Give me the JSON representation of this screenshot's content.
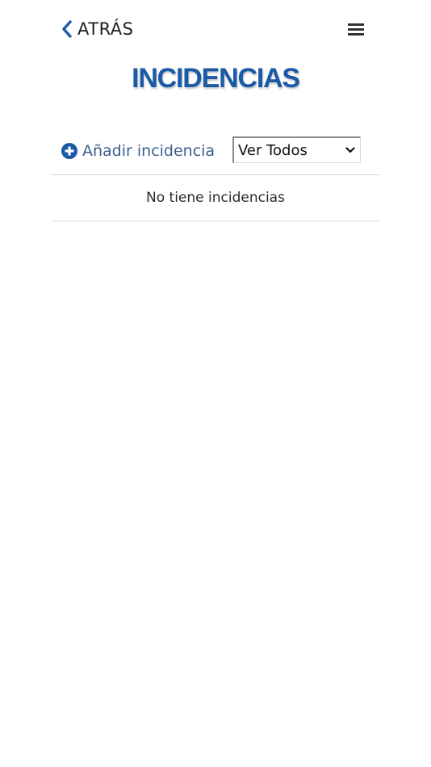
{
  "header": {
    "back_label": "ATRÁS",
    "back_icon": "chevron-left-icon",
    "menu_icon": "hamburger-menu-icon"
  },
  "page": {
    "title": "INCIDENCIAS"
  },
  "toolbar": {
    "add_label": "Añadir incidencia",
    "add_icon": "plus-circle-icon",
    "filter": {
      "selected": "Ver Todos"
    }
  },
  "list": {
    "empty_message": "No tiene incidencias"
  },
  "colors": {
    "brand_blue": "#1b5aa6",
    "link_blue": "#3a5f8f",
    "text": "#222222"
  }
}
